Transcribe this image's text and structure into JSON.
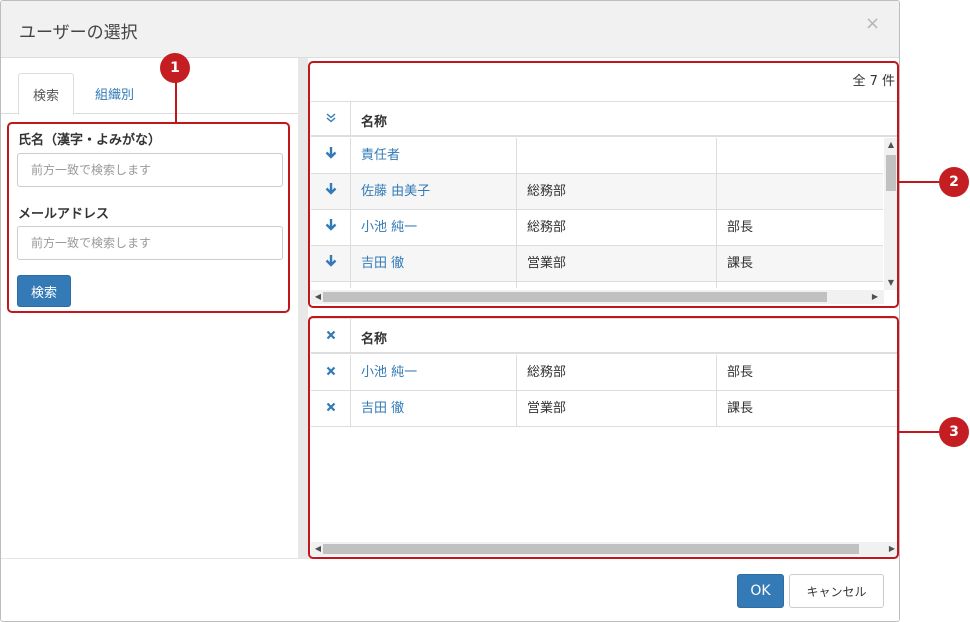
{
  "dialog": {
    "title": "ユーザーの選択",
    "close_label": "×"
  },
  "search_panel": {
    "tabs": [
      {
        "label": "検索",
        "active": true
      },
      {
        "label": "組織別",
        "active": false
      }
    ],
    "name_field": {
      "label": "氏名（漢字・よみがな）",
      "value": "",
      "placeholder": "前方一致で検索します"
    },
    "email_field": {
      "label": "メールアドレス",
      "value": "",
      "placeholder": "前方一致で検索します"
    },
    "search_button": "検索"
  },
  "results": {
    "count_text": "全 7 件",
    "header_icon": "double-chevron-down-icon",
    "column_name": "名称",
    "rows": [
      {
        "name": "責任者",
        "department": "",
        "title": "",
        "icon": "arrow-down-icon"
      },
      {
        "name": "佐藤 由美子",
        "department": "総務部",
        "title": "",
        "icon": "arrow-down-icon"
      },
      {
        "name": "小池 純一",
        "department": "総務部",
        "title": "部長",
        "icon": "arrow-down-icon"
      },
      {
        "name": "吉田 徹",
        "department": "営業部",
        "title": "課長",
        "icon": "arrow-down-icon"
      }
    ]
  },
  "selected": {
    "header_icon": "remove-all-icon",
    "column_name": "名称",
    "rows": [
      {
        "name": "小池 純一",
        "department": "総務部",
        "title": "部長",
        "icon": "remove-icon"
      },
      {
        "name": "吉田 徹",
        "department": "営業部",
        "title": "課長",
        "icon": "remove-icon"
      }
    ]
  },
  "footer": {
    "ok_button": "OK",
    "cancel_button": "キャンセル"
  },
  "callouts": [
    {
      "number": "1"
    },
    {
      "number": "2"
    },
    {
      "number": "3"
    }
  ],
  "colors": {
    "link": "#337ab7",
    "primary_button": "#337ab7",
    "callout_red": "#c41e23",
    "row_alt": "#f6f6f6"
  }
}
